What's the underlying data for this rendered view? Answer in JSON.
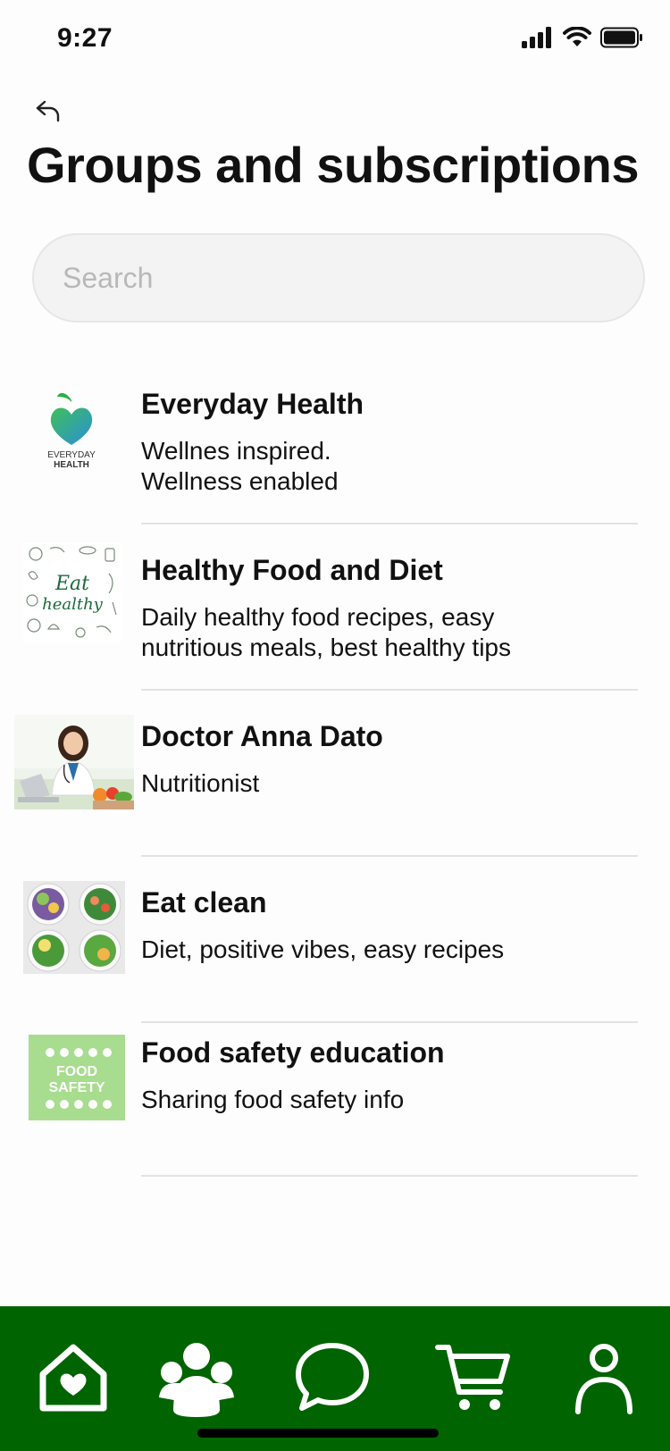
{
  "status": {
    "time": "9:27"
  },
  "header": {
    "title": "Groups and subscriptions"
  },
  "search": {
    "placeholder": "Search",
    "value": ""
  },
  "items": [
    {
      "title": "Everyday Health",
      "description": "Wellnes inspired.\nWellness enabled",
      "logo_text": "EVERYDAY",
      "logo_text2": "HEALTH",
      "thumbnail": "apple-heart-logo"
    },
    {
      "title": "Healthy Food and Diet",
      "description": "Daily healthy food recipes, easy\nnutritious meals, best healthy tips",
      "logo_text": "Eat",
      "logo_text2": "healthy",
      "thumbnail": "eat-healthy-sketch"
    },
    {
      "title": "Doctor Anna Dato",
      "description": "Nutritionist",
      "thumbnail": "doctor-photo"
    },
    {
      "title": "Eat clean",
      "description": "Diet, positive vibes, easy recipes",
      "thumbnail": "salad-bowls"
    },
    {
      "title": "Food safety education",
      "description": "Sharing food safety info",
      "logo_text": "FOOD",
      "logo_text2": "SAFETY",
      "thumbnail": "food-safety-badge"
    }
  ],
  "tabbar": {
    "items": [
      {
        "icon": "home-heart-icon"
      },
      {
        "icon": "group-icon"
      },
      {
        "icon": "chat-icon"
      },
      {
        "icon": "cart-icon"
      },
      {
        "icon": "profile-icon"
      }
    ]
  },
  "colors": {
    "brand": "#006400",
    "divider": "#e2e2e2",
    "search_bg": "#f3f3f3"
  }
}
